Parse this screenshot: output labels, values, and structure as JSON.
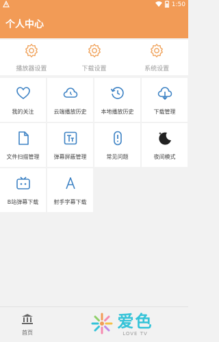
{
  "status_bar": {
    "left_icon": "android-debug-icon",
    "time": "1:50"
  },
  "header": {
    "title": "个人中心"
  },
  "settings": [
    {
      "label": "播放器设置",
      "icon": "gear-icon"
    },
    {
      "label": "下载设置",
      "icon": "gear-icon"
    },
    {
      "label": "系统设置",
      "icon": "gear-icon"
    }
  ],
  "features": [
    {
      "label": "我的关注",
      "icon": "heart-icon"
    },
    {
      "label": "云端播放历史",
      "icon": "cloud-history-icon"
    },
    {
      "label": "本地播放历史",
      "icon": "clock-history-icon"
    },
    {
      "label": "下载管理",
      "icon": "cloud-download-icon"
    },
    {
      "label": "文件扫描管理",
      "icon": "file-icon"
    },
    {
      "label": "弹幕屏蔽管理",
      "icon": "text-block-icon"
    },
    {
      "label": "常见问题",
      "icon": "question-icon"
    },
    {
      "label": "夜间模式",
      "icon": "moon-icon"
    },
    {
      "label": "B站弹幕下载",
      "icon": "tv-icon"
    },
    {
      "label": "射手字幕下载",
      "icon": "letter-a-icon"
    }
  ],
  "bottom_nav": {
    "home_label": "首页",
    "logo_cn": "爱色",
    "logo_en": "LOVE TV"
  },
  "colors": {
    "accent": "#f29b56",
    "icon_orange": "#f0a25a",
    "icon_blue": "#3d82c4",
    "logo_cyan": "#34c3d8"
  }
}
